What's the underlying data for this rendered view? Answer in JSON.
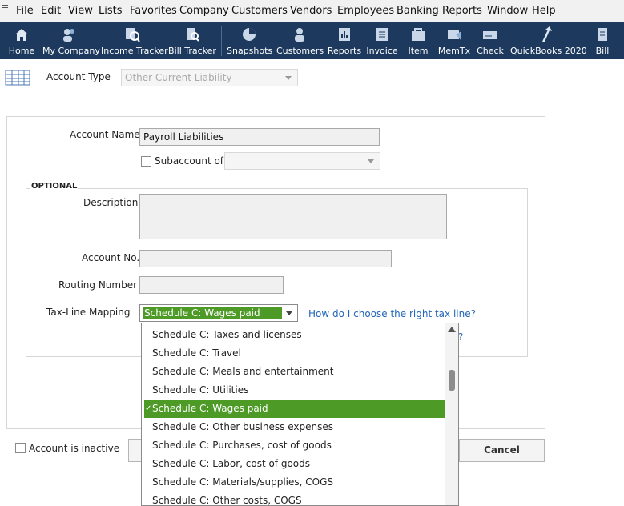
{
  "menu": [
    "File",
    "Edit",
    "View",
    "Lists",
    "Favorites",
    "Company",
    "Customers",
    "Vendors",
    "Employees",
    "Banking",
    "Reports",
    "Window",
    "Help"
  ],
  "toolbar": [
    "Home",
    "My Company",
    "Income Tracker",
    "Bill Tracker",
    "Snapshots",
    "Customers",
    "Reports",
    "Invoice",
    "Item",
    "MemTx",
    "Check",
    "QuickBooks 2020",
    "Bill"
  ],
  "toolbar_icons": [
    "home-icon",
    "my-company-icon",
    "income-tracker-icon",
    "bill-tracker-icon",
    "snapshots-icon",
    "customers-icon",
    "reports-icon",
    "invoice-icon",
    "item-icon",
    "memtx-icon",
    "check-icon",
    "quickbooks-2020-icon",
    "bill-icon"
  ],
  "form": {
    "account_type_label": "Account Type",
    "account_type_value": "Other Current Liability",
    "account_name_label": "Account Name",
    "account_name_value": "Payroll Liabilities",
    "subaccount_label": "Subaccount of",
    "optional_label": "OPTIONAL",
    "description_label": "Description",
    "account_no_label": "Account No.",
    "routing_number_label": "Routing Number",
    "tax_line_label": "Tax-Line Mapping",
    "tax_line_value": "Schedule C: Wages paid",
    "tax_line_help": "How do I choose the right tax line?",
    "hidden_link_tail": "?",
    "inactive_label": "Account is inactive",
    "cancel_button": "Cancel"
  },
  "tax_line_options": [
    "Schedule C: Taxes and licenses",
    "Schedule C: Travel",
    "Schedule C: Meals and entertainment",
    "Schedule C: Utilities",
    "Schedule C: Wages paid",
    "Schedule C: Other business expenses",
    "Schedule C: Purchases, cost of goods",
    "Schedule C: Labor, cost of goods",
    "Schedule C: Materials/supplies, COGS",
    "Schedule C: Other costs, COGS"
  ],
  "tax_line_selected_index": 4,
  "colors": {
    "toolbar_bg": "#1d3a5e",
    "selection": "#4d9a26",
    "link": "#2266bb"
  }
}
